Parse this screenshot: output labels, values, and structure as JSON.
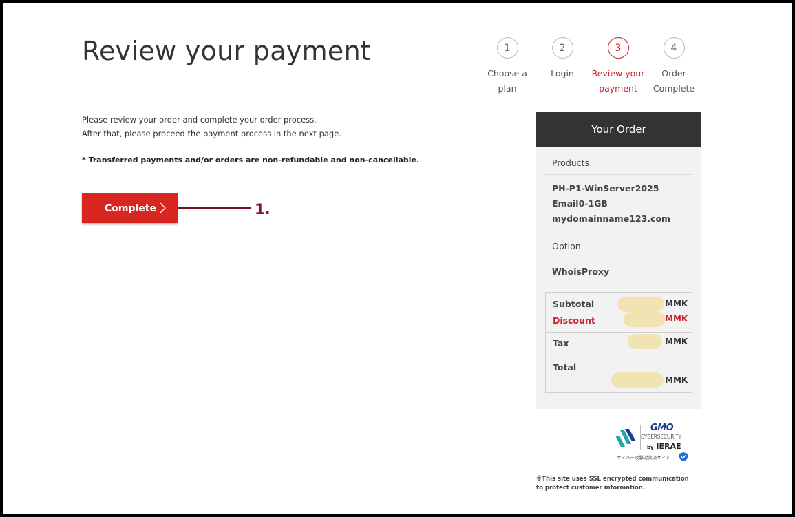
{
  "page": {
    "title": "Review your payment",
    "intro_line1": "Please review your order and complete your order process.",
    "intro_line2": "After that, please proceed the payment process in the next page.",
    "notice": "* Transferred payments and/or orders are non-refundable and non-cancellable.",
    "complete_label": "Complete",
    "annotation": "1."
  },
  "steps": [
    {
      "number": "1",
      "label_line1": "Choose a",
      "label_line2": "plan",
      "active": false
    },
    {
      "number": "2",
      "label_line1": "Login",
      "label_line2": "",
      "active": false
    },
    {
      "number": "3",
      "label_line1": "Review your",
      "label_line2": "payment",
      "active": true
    },
    {
      "number": "4",
      "label_line1": "Order",
      "label_line2": "Complete",
      "active": false
    }
  ],
  "order": {
    "heading": "Your Order",
    "products_label": "Products",
    "products": [
      "PH-P1-WinServer2025",
      "Email0-1GB",
      "mydomainname123.com"
    ],
    "option_label": "Option",
    "options": [
      "WhoisProxy"
    ],
    "subtotal_label": "Subtotal",
    "discount_label": "Discount",
    "tax_label": "Tax",
    "total_label": "Total",
    "currency": "MMK"
  },
  "badge": {
    "brand": "GMO",
    "line1": "CYBERSECURITY",
    "by": "by",
    "name": "IERAE",
    "jp": "サイバー攻撃対策済サイト"
  },
  "ssl_note": "※This site uses SSL encrypted communication to protect customer information.",
  "colors": {
    "accent_red": "#d7261f",
    "active_step": "#c8232c",
    "order_header": "#333333",
    "annotation": "#8b1227",
    "redaction": "#f2e3b3"
  }
}
